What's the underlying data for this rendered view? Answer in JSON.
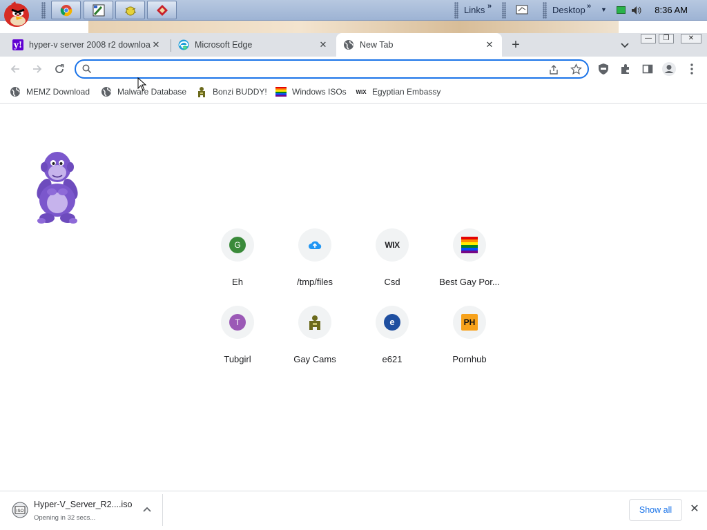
{
  "taskbar": {
    "start_icon": "angry-bird-icon",
    "quick_launch": [
      {
        "icon": "chrome-icon"
      },
      {
        "icon": "paint-icon"
      },
      {
        "icon": "bug-icon"
      },
      {
        "icon": "red-diamond-icon"
      }
    ],
    "links_label": "Links",
    "desktop_label": "Desktop",
    "clock": "8:36 AM",
    "tray_icons": [
      "display-icon",
      "network-icon",
      "volume-icon"
    ]
  },
  "tabs": [
    {
      "title": "hyper-v server 2008 r2 download",
      "icon": "yahoo-icon",
      "close": "✕"
    },
    {
      "title": "Microsoft Edge",
      "icon": "edge-icon",
      "close": "✕"
    },
    {
      "title": "New Tab",
      "icon": "globe-icon",
      "close": "✕",
      "active": true
    }
  ],
  "newtab_plus": "+",
  "window_buttons": {
    "minimize": "—",
    "restore": "❐",
    "close": "✕"
  },
  "omnibox": {
    "value": "",
    "placeholder": ""
  },
  "bookmarks": [
    {
      "label": "MEMZ Download",
      "icon": "globe-icon"
    },
    {
      "label": "Malware Database",
      "icon": "globe-icon"
    },
    {
      "label": "Bonzi BUDDY!",
      "icon": "bonzi-icon"
    },
    {
      "label": "Windows ISOs",
      "icon": "rainbow-flag-icon"
    },
    {
      "label": "Egyptian Embassy",
      "icon": "wix-icon"
    }
  ],
  "shortcuts": [
    {
      "label": "Eh",
      "icon_text": "G",
      "icon_color": "#34a853",
      "icon": "letter-icon"
    },
    {
      "label": "/tmp/files",
      "icon_text": "",
      "icon": "cloud-upload-icon"
    },
    {
      "label": "Csd",
      "icon_text": "WIX",
      "icon": "wix-icon"
    },
    {
      "label": "Best Gay Por...",
      "icon_text": "",
      "icon": "rainbow-flag-icon"
    },
    {
      "label": "Tubgirl",
      "icon_text": "T",
      "icon_color": "#9b59b6",
      "icon": "letter-icon"
    },
    {
      "label": "Gay Cams",
      "icon_text": "",
      "icon": "people-icon"
    },
    {
      "label": "e621",
      "icon_text": "e",
      "icon": "e621-icon"
    },
    {
      "label": "Pornhub",
      "icon_text": "PH",
      "icon": "ph-icon"
    }
  ],
  "download": {
    "filename": "Hyper-V_Server_R2....iso",
    "status": "Opening in 32 secs...",
    "show_all": "Show all",
    "close": "✕"
  },
  "colors": {
    "accent": "#1a73e8",
    "tab_strip": "#dee1e6",
    "taskbar": "#a9bcd9"
  }
}
